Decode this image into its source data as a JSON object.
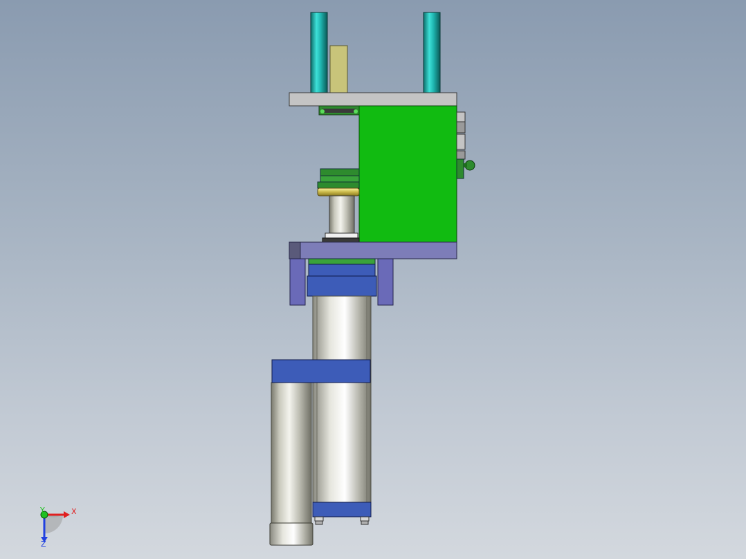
{
  "viewport": {
    "background_top": "#8a9bb0",
    "background_bottom": "#d3d8de"
  },
  "model": {
    "colors": {
      "guide_post": "#1fb5b0",
      "plate_gray": "#c4c4c4",
      "body_green": "#11bb11",
      "base_plate": "#7d7db8",
      "cylinder_blue": "#3d5cb8",
      "chrome": "#d0d0d0",
      "brass": "#c9b84a",
      "khaki": "#c8c47a",
      "dark_green": "#2e8b2e"
    }
  },
  "triad": {
    "x_label": "X",
    "y_label": "Y",
    "z_label": "Z",
    "x_color": "#e02020",
    "y_color": "#20c020",
    "z_color": "#2040e0"
  }
}
